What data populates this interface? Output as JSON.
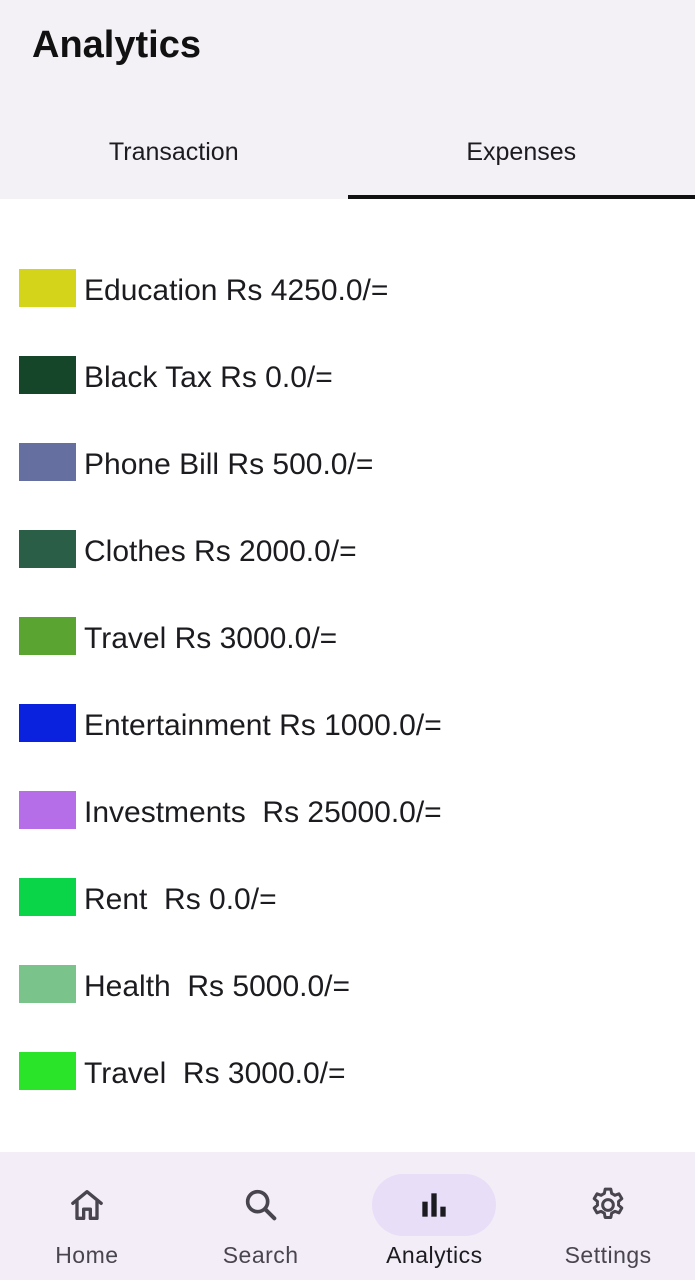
{
  "header": {
    "title": "Analytics"
  },
  "tabs": [
    {
      "label": "Transaction",
      "active": false
    },
    {
      "label": "Expenses",
      "active": true
    }
  ],
  "legend": [
    {
      "text": "Education Rs 4250.0/=",
      "color": "#d4d41a"
    },
    {
      "text": "Black Tax Rs 0.0/=",
      "color": "#16462a"
    },
    {
      "text": "Phone Bill Rs 500.0/=",
      "color": "#6570a0"
    },
    {
      "text": "Clothes Rs 2000.0/=",
      "color": "#2a5e46"
    },
    {
      "text": "Travel Rs 3000.0/=",
      "color": "#5aa432"
    },
    {
      "text": "Entertainment Rs 1000.0/=",
      "color": "#0a22de"
    },
    {
      "text": "Investments  Rs 25000.0/=",
      "color": "#b56ee8"
    },
    {
      "text": "Rent  Rs 0.0/=",
      "color": "#0ad448"
    },
    {
      "text": "Health  Rs 5000.0/=",
      "color": "#7ac48c"
    },
    {
      "text": "Travel  Rs 3000.0/=",
      "color": "#2ae42a"
    }
  ],
  "bottom_nav": [
    {
      "label": "Home",
      "icon": "home-icon",
      "active": false
    },
    {
      "label": "Search",
      "icon": "search-icon",
      "active": false
    },
    {
      "label": "Analytics",
      "icon": "bar-chart-icon",
      "active": true
    },
    {
      "label": "Settings",
      "icon": "gear-icon",
      "active": false
    }
  ]
}
